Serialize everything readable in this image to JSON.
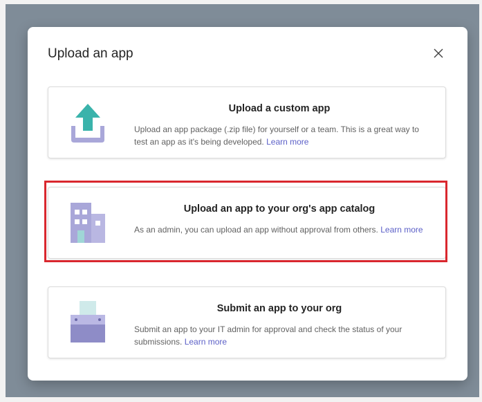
{
  "dialog": {
    "title": "Upload an app",
    "close_icon": "close-icon"
  },
  "options": [
    {
      "title": "Upload a custom app",
      "description": "Upload an app package (.zip file) for yourself or a team. This is a great way to test an app as it's being developed.",
      "link": "Learn more",
      "icon": "upload-arrow-icon"
    },
    {
      "title": "Upload an app to your org's app catalog",
      "description": "As an admin, you can upload an app without approval from others.",
      "link": "Learn more",
      "icon": "building-icon",
      "highlighted": true
    },
    {
      "title": "Submit an app to your org",
      "description": "Submit an app to your IT admin for approval and check the status of your submissions.",
      "link": "Learn more",
      "icon": "submit-box-icon"
    }
  ],
  "colors": {
    "highlight": "#d9272e",
    "link": "#5b5fc7",
    "upload_arrow": "#3ab3ab",
    "icon_purple": "#a9a7d9"
  }
}
